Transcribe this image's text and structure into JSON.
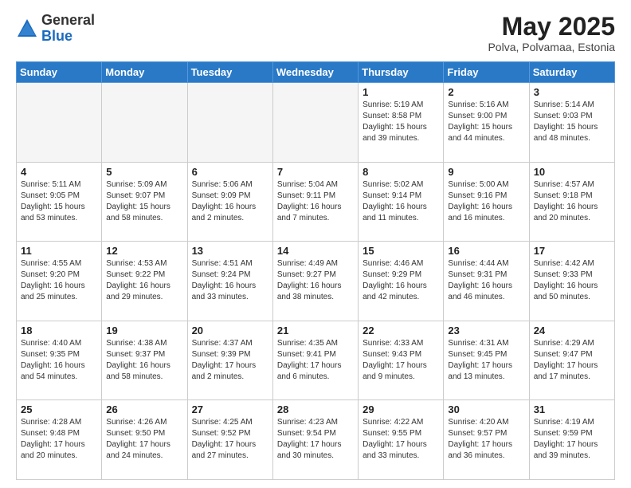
{
  "header": {
    "logo": {
      "general": "General",
      "blue": "Blue"
    },
    "title": "May 2025",
    "location": "Polva, Polvamaa, Estonia"
  },
  "weekdays": [
    "Sunday",
    "Monday",
    "Tuesday",
    "Wednesday",
    "Thursday",
    "Friday",
    "Saturday"
  ],
  "weeks": [
    [
      {
        "day": null,
        "empty": true
      },
      {
        "day": null,
        "empty": true
      },
      {
        "day": null,
        "empty": true
      },
      {
        "day": null,
        "empty": true
      },
      {
        "day": 1,
        "sunrise": "5:19 AM",
        "sunset": "8:58 PM",
        "daylight": "15 hours and 39 minutes."
      },
      {
        "day": 2,
        "sunrise": "5:16 AM",
        "sunset": "9:00 PM",
        "daylight": "15 hours and 44 minutes."
      },
      {
        "day": 3,
        "sunrise": "5:14 AM",
        "sunset": "9:03 PM",
        "daylight": "15 hours and 48 minutes."
      }
    ],
    [
      {
        "day": 4,
        "sunrise": "5:11 AM",
        "sunset": "9:05 PM",
        "daylight": "15 hours and 53 minutes."
      },
      {
        "day": 5,
        "sunrise": "5:09 AM",
        "sunset": "9:07 PM",
        "daylight": "15 hours and 58 minutes."
      },
      {
        "day": 6,
        "sunrise": "5:06 AM",
        "sunset": "9:09 PM",
        "daylight": "16 hours and 2 minutes."
      },
      {
        "day": 7,
        "sunrise": "5:04 AM",
        "sunset": "9:11 PM",
        "daylight": "16 hours and 7 minutes."
      },
      {
        "day": 8,
        "sunrise": "5:02 AM",
        "sunset": "9:14 PM",
        "daylight": "16 hours and 11 minutes."
      },
      {
        "day": 9,
        "sunrise": "5:00 AM",
        "sunset": "9:16 PM",
        "daylight": "16 hours and 16 minutes."
      },
      {
        "day": 10,
        "sunrise": "4:57 AM",
        "sunset": "9:18 PM",
        "daylight": "16 hours and 20 minutes."
      }
    ],
    [
      {
        "day": 11,
        "sunrise": "4:55 AM",
        "sunset": "9:20 PM",
        "daylight": "16 hours and 25 minutes."
      },
      {
        "day": 12,
        "sunrise": "4:53 AM",
        "sunset": "9:22 PM",
        "daylight": "16 hours and 29 minutes."
      },
      {
        "day": 13,
        "sunrise": "4:51 AM",
        "sunset": "9:24 PM",
        "daylight": "16 hours and 33 minutes."
      },
      {
        "day": 14,
        "sunrise": "4:49 AM",
        "sunset": "9:27 PM",
        "daylight": "16 hours and 38 minutes."
      },
      {
        "day": 15,
        "sunrise": "4:46 AM",
        "sunset": "9:29 PM",
        "daylight": "16 hours and 42 minutes."
      },
      {
        "day": 16,
        "sunrise": "4:44 AM",
        "sunset": "9:31 PM",
        "daylight": "16 hours and 46 minutes."
      },
      {
        "day": 17,
        "sunrise": "4:42 AM",
        "sunset": "9:33 PM",
        "daylight": "16 hours and 50 minutes."
      }
    ],
    [
      {
        "day": 18,
        "sunrise": "4:40 AM",
        "sunset": "9:35 PM",
        "daylight": "16 hours and 54 minutes."
      },
      {
        "day": 19,
        "sunrise": "4:38 AM",
        "sunset": "9:37 PM",
        "daylight": "16 hours and 58 minutes."
      },
      {
        "day": 20,
        "sunrise": "4:37 AM",
        "sunset": "9:39 PM",
        "daylight": "17 hours and 2 minutes."
      },
      {
        "day": 21,
        "sunrise": "4:35 AM",
        "sunset": "9:41 PM",
        "daylight": "17 hours and 6 minutes."
      },
      {
        "day": 22,
        "sunrise": "4:33 AM",
        "sunset": "9:43 PM",
        "daylight": "17 hours and 9 minutes."
      },
      {
        "day": 23,
        "sunrise": "4:31 AM",
        "sunset": "9:45 PM",
        "daylight": "17 hours and 13 minutes."
      },
      {
        "day": 24,
        "sunrise": "4:29 AM",
        "sunset": "9:47 PM",
        "daylight": "17 hours and 17 minutes."
      }
    ],
    [
      {
        "day": 25,
        "sunrise": "4:28 AM",
        "sunset": "9:48 PM",
        "daylight": "17 hours and 20 minutes."
      },
      {
        "day": 26,
        "sunrise": "4:26 AM",
        "sunset": "9:50 PM",
        "daylight": "17 hours and 24 minutes."
      },
      {
        "day": 27,
        "sunrise": "4:25 AM",
        "sunset": "9:52 PM",
        "daylight": "17 hours and 27 minutes."
      },
      {
        "day": 28,
        "sunrise": "4:23 AM",
        "sunset": "9:54 PM",
        "daylight": "17 hours and 30 minutes."
      },
      {
        "day": 29,
        "sunrise": "4:22 AM",
        "sunset": "9:55 PM",
        "daylight": "17 hours and 33 minutes."
      },
      {
        "day": 30,
        "sunrise": "4:20 AM",
        "sunset": "9:57 PM",
        "daylight": "17 hours and 36 minutes."
      },
      {
        "day": 31,
        "sunrise": "4:19 AM",
        "sunset": "9:59 PM",
        "daylight": "17 hours and 39 minutes."
      }
    ]
  ]
}
